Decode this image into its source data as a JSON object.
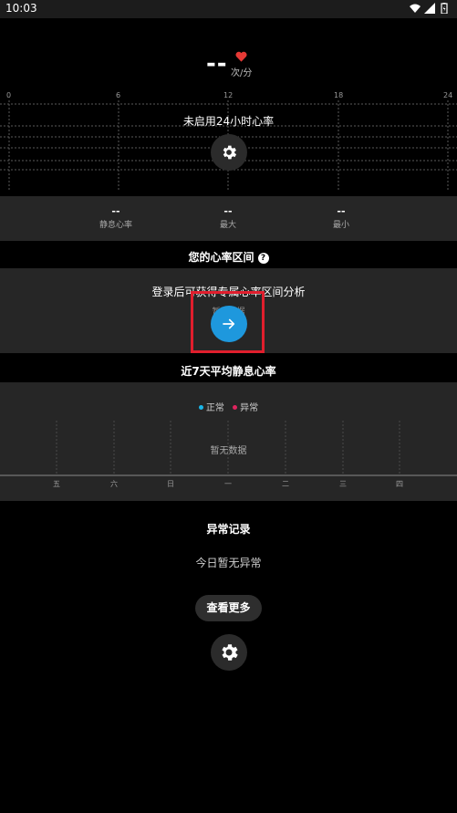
{
  "status_bar": {
    "time": "10:03"
  },
  "heart_rate": {
    "value": "--",
    "unit": "次/分"
  },
  "chart": {
    "x_ticks": [
      "0",
      "6",
      "12",
      "18",
      "24"
    ],
    "message": "未启用24小时心率"
  },
  "stats": [
    {
      "value": "--",
      "label": "静息心率"
    },
    {
      "value": "--",
      "label": "最大"
    },
    {
      "value": "--",
      "label": "最小"
    }
  ],
  "zone": {
    "title": "您的心率区间",
    "message": "登录后可获得专属心率区间分析",
    "sub": "暂无数据"
  },
  "resting": {
    "title": "近7天平均静息心率",
    "legend": [
      {
        "label": "正常",
        "color": "#1ab6e8"
      },
      {
        "label": "异常",
        "color": "#e0245e"
      }
    ],
    "no_data": "暂无数据",
    "days": [
      "五",
      "六",
      "日",
      "一",
      "二",
      "三",
      "四"
    ]
  },
  "abnormal": {
    "title": "异常记录",
    "message": "今日暂无异常",
    "more_label": "查看更多"
  },
  "colors": {
    "accent": "#1e98dd",
    "highlight": "#e01e2d",
    "heart": "#e53935"
  },
  "icons": [
    "gear-icon",
    "arrow-right-icon",
    "heart-icon",
    "help-icon",
    "wifi-icon",
    "signal-icon",
    "battery-icon"
  ]
}
